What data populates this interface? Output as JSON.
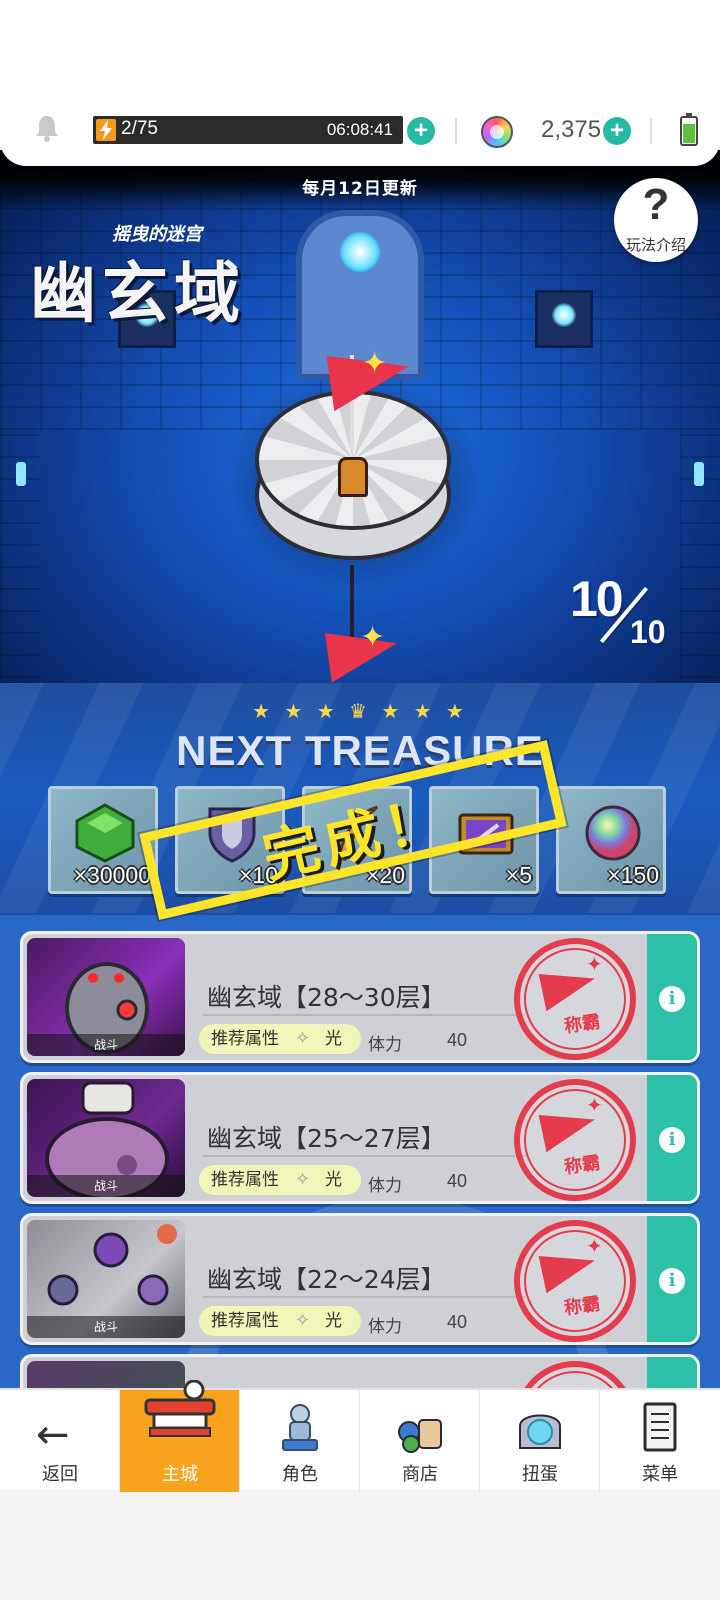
{
  "status": {
    "stamina_text": "2/75",
    "timer": "06:08:41",
    "gem_count": "2,375"
  },
  "hero": {
    "update_notice": "每月12日更新",
    "help_label": "玩法介绍",
    "help_symbol": "?",
    "subtitle": "摇曳的迷宫",
    "title": "幽玄域",
    "progress_current": "10",
    "progress_total": "10"
  },
  "treasure": {
    "title": "NEXT TREASURE",
    "stamp": "完成！",
    "rewards": [
      {
        "icon": "green-gem-icon",
        "qty": "×30000"
      },
      {
        "icon": "emblem-icon",
        "qty": "×10"
      },
      {
        "icon": "feather-icon",
        "qty": "×20"
      },
      {
        "icon": "ticket-icon",
        "qty": "×5"
      },
      {
        "icon": "rainbow-orb-icon",
        "qty": "×150"
      }
    ]
  },
  "stages": [
    {
      "name": "幽玄域【28～30层】",
      "tag": "战斗",
      "attr_label": "推荐属性",
      "attr_value": "光",
      "stamina_label": "体力",
      "stamina_cost": "40",
      "seal": "称霸"
    },
    {
      "name": "幽玄域【25～27层】",
      "tag": "战斗",
      "attr_label": "推荐属性",
      "attr_value": "光",
      "stamina_label": "体力",
      "stamina_cost": "40",
      "seal": "称霸"
    },
    {
      "name": "幽玄域【22～24层】",
      "tag": "战斗",
      "attr_label": "推荐属性",
      "attr_value": "光",
      "stamina_label": "体力",
      "stamina_cost": "40",
      "seal": "称霸"
    }
  ],
  "nav": {
    "back": "返回",
    "home": "主城",
    "characters": "角色",
    "shop": "商店",
    "gacha": "扭蛋",
    "menu": "菜单"
  },
  "colors": {
    "accent_teal": "#2cc0a8",
    "seal_red": "#e43b4d",
    "nav_active": "#f9a31f",
    "stamp_yellow": "#ffe52a"
  }
}
